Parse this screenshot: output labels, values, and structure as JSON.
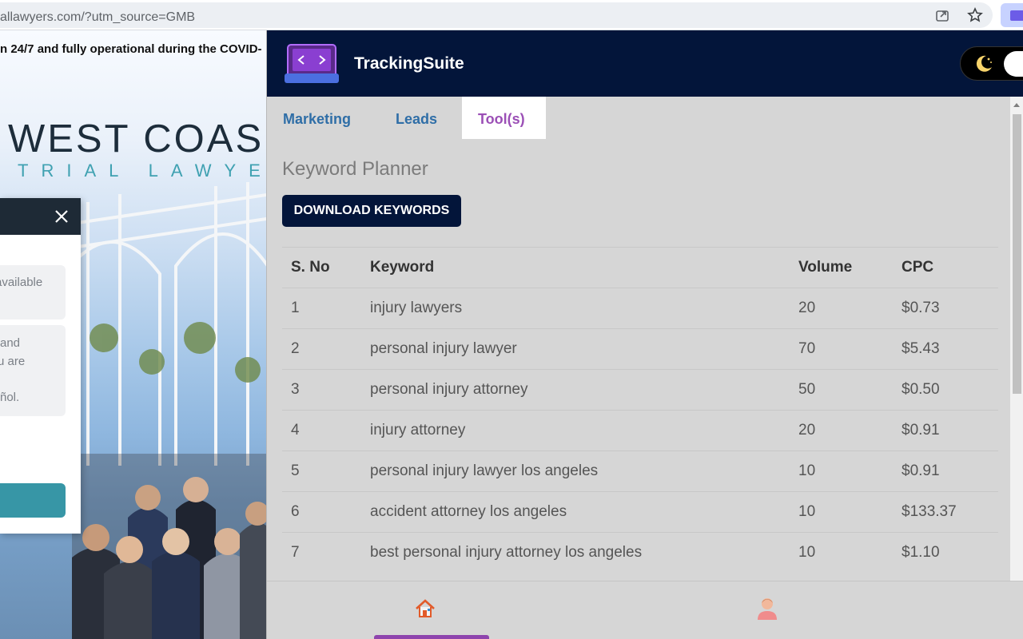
{
  "browser": {
    "url": "allawyers.com/?utm_source=GMB",
    "icons": {
      "share": "share-icon",
      "bookmark": "star-icon",
      "extension": "extension-icon"
    }
  },
  "website": {
    "notice": "n 24/7 and fully operational during the COVID-",
    "logo_line1": "WEST COAS",
    "logo_line2": "TRIAL LAWYER",
    "chat": {
      "bubble1": [
        "available"
      ],
      "bubble2": [
        "and",
        "u are",
        "",
        "ñol."
      ]
    }
  },
  "extension": {
    "brand": "TrackingSuite",
    "tabs": [
      {
        "label": "Marketing",
        "active": false
      },
      {
        "label": "Leads",
        "active": false
      },
      {
        "label": "Tool(s)",
        "active": true
      }
    ],
    "tool": {
      "title": "Keyword Planner",
      "download_label": "DOWNLOAD KEYWORDS",
      "columns": [
        "S. No",
        "Keyword",
        "Volume",
        "CPC"
      ],
      "rows": [
        [
          "1",
          "injury lawyers",
          "20",
          "$0.73"
        ],
        [
          "2",
          "personal injury lawyer",
          "70",
          "$5.43"
        ],
        [
          "3",
          "personal injury attorney",
          "50",
          "$0.50"
        ],
        [
          "4",
          "injury attorney",
          "20",
          "$0.91"
        ],
        [
          "5",
          "personal injury lawyer los angeles",
          "10",
          "$0.91"
        ],
        [
          "6",
          "accident attorney los angeles",
          "10",
          "$133.37"
        ],
        [
          "7",
          "best personal injury attorney los angeles",
          "10",
          "$1.10"
        ]
      ]
    },
    "nav": {
      "home": "home-icon",
      "profile": "user-icon"
    },
    "colors": {
      "header": "#03153a",
      "active_tab": "#9b4fb6",
      "tab": "#2f6ea7",
      "panel_bg": "#d6d6d6"
    }
  }
}
